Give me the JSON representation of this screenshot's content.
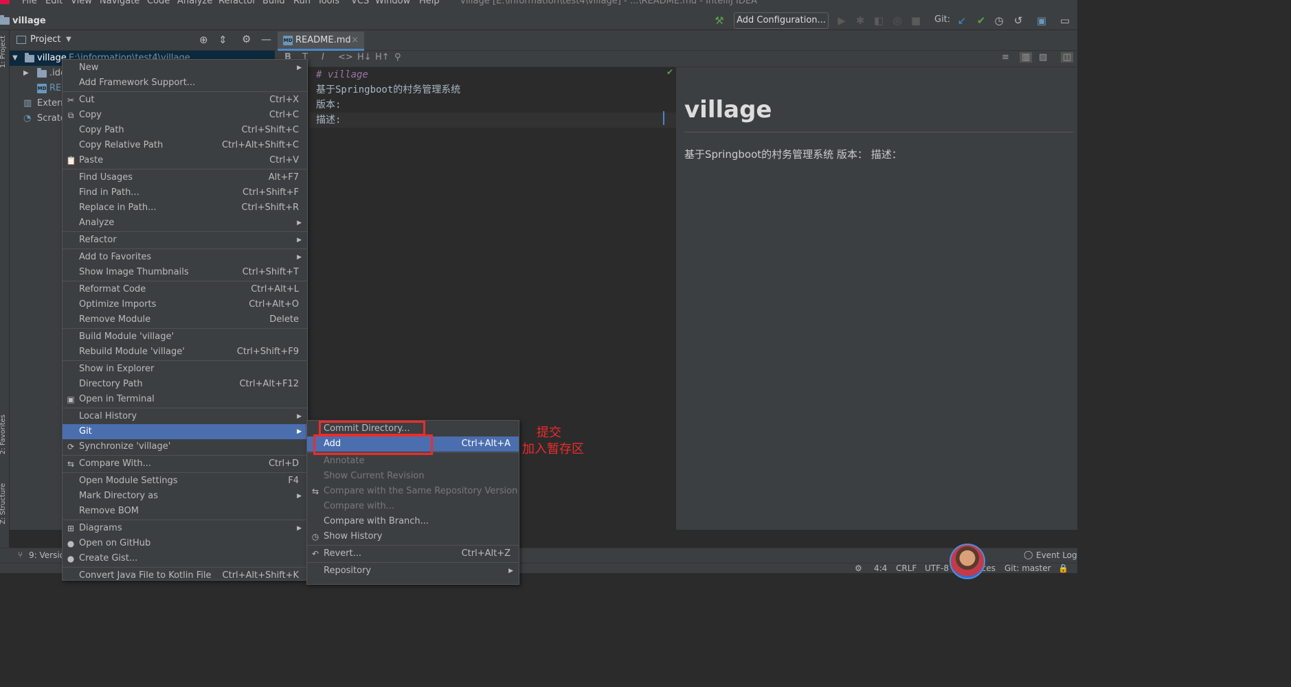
{
  "window_title": "village [E:\\information\\test4\\village] - ...\\README.md - IntelliJ IDEA",
  "menubar": [
    "File",
    "Edit",
    "View",
    "Navigate",
    "Code",
    "Analyze",
    "Refactor",
    "Build",
    "Run",
    "Tools",
    "VCS",
    "Window",
    "Help"
  ],
  "breadcrumb": "village",
  "toolbar": {
    "add_configuration": "Add Configuration...",
    "git_label": "Git:"
  },
  "left_strip": {
    "project": "1: Project",
    "favorites": "2: Favorites",
    "structure": "Z: Structure"
  },
  "project_panel": {
    "title": "Project",
    "root": {
      "name": "village",
      "path": "E:\\information\\test4\\village"
    },
    "items": [
      ".idea",
      "README.md",
      "External Libraries",
      "Scratches and Consoles"
    ]
  },
  "tree_visible": [
    ".ide",
    "RE",
    "Extern",
    "Scrato"
  ],
  "editor": {
    "tab": "README.md",
    "lines": [
      "# village",
      "基于Springboot的村务管理系统",
      "版本:",
      "描述:"
    ]
  },
  "preview": {
    "heading": "village",
    "paragraph": "基于Springboot的村务管理系统 版本： 描述："
  },
  "context_menu": [
    {
      "label": "New",
      "arrow": true
    },
    {
      "label": "Add Framework Support..."
    },
    {
      "sep": true
    },
    {
      "label": "Cut",
      "shortcut": "Ctrl+X",
      "icon": "scissors-icon"
    },
    {
      "label": "Copy",
      "shortcut": "Ctrl+C",
      "icon": "copy-icon"
    },
    {
      "label": "Copy Path",
      "shortcut": "Ctrl+Shift+C"
    },
    {
      "label": "Copy Relative Path",
      "shortcut": "Ctrl+Alt+Shift+C"
    },
    {
      "label": "Paste",
      "shortcut": "Ctrl+V",
      "icon": "paste-icon"
    },
    {
      "sep": true
    },
    {
      "label": "Find Usages",
      "shortcut": "Alt+F7"
    },
    {
      "label": "Find in Path...",
      "shortcut": "Ctrl+Shift+F"
    },
    {
      "label": "Replace in Path...",
      "shortcut": "Ctrl+Shift+R"
    },
    {
      "label": "Analyze",
      "arrow": true
    },
    {
      "sep": true
    },
    {
      "label": "Refactor",
      "arrow": true
    },
    {
      "sep": true
    },
    {
      "label": "Add to Favorites",
      "arrow": true
    },
    {
      "label": "Show Image Thumbnails",
      "shortcut": "Ctrl+Shift+T"
    },
    {
      "sep": true
    },
    {
      "label": "Reformat Code",
      "shortcut": "Ctrl+Alt+L"
    },
    {
      "label": "Optimize Imports",
      "shortcut": "Ctrl+Alt+O"
    },
    {
      "label": "Remove Module",
      "shortcut": "Delete"
    },
    {
      "sep": true
    },
    {
      "label": "Build Module 'village'"
    },
    {
      "label": "Rebuild Module 'village'",
      "shortcut": "Ctrl+Shift+F9"
    },
    {
      "sep": true
    },
    {
      "label": "Show in Explorer"
    },
    {
      "label": "Directory Path",
      "shortcut": "Ctrl+Alt+F12"
    },
    {
      "label": "Open in Terminal",
      "icon": "terminal-icon"
    },
    {
      "sep": true
    },
    {
      "label": "Local History",
      "arrow": true
    },
    {
      "label": "Git",
      "arrow": true,
      "selected": true
    },
    {
      "label": "Synchronize 'village'",
      "icon": "sync-icon"
    },
    {
      "sep": true
    },
    {
      "label": "Compare With...",
      "shortcut": "Ctrl+D",
      "icon": "compare-icon"
    },
    {
      "sep": true
    },
    {
      "label": "Open Module Settings",
      "shortcut": "F4"
    },
    {
      "label": "Mark Directory as",
      "arrow": true
    },
    {
      "label": "Remove BOM"
    },
    {
      "sep": true
    },
    {
      "label": "Diagrams",
      "arrow": true,
      "icon": "diagram-icon"
    },
    {
      "label": "Open on GitHub",
      "icon": "github-icon"
    },
    {
      "label": "Create Gist...",
      "icon": "github-icon"
    },
    {
      "sep": true
    },
    {
      "label": "Convert Java File to Kotlin File",
      "shortcut": "Ctrl+Alt+Shift+K"
    }
  ],
  "git_submenu": [
    {
      "label": "Commit Directory..."
    },
    {
      "label": "Add",
      "shortcut": "Ctrl+Alt+A",
      "selected": true
    },
    {
      "sep": true
    },
    {
      "label": "Annotate",
      "disabled": true
    },
    {
      "label": "Show Current Revision",
      "disabled": true
    },
    {
      "label": "Compare with the Same Repository Version",
      "disabled": true,
      "icon": "compare-icon"
    },
    {
      "label": "Compare with...",
      "disabled": true
    },
    {
      "label": "Compare with Branch..."
    },
    {
      "label": "Show History",
      "icon": "clock-icon"
    },
    {
      "sep": true
    },
    {
      "label": "Revert...",
      "shortcut": "Ctrl+Alt+Z",
      "icon": "revert-icon"
    },
    {
      "sep": true
    },
    {
      "label": "Repository",
      "arrow": true
    }
  ],
  "annotations": {
    "commit": "提交",
    "add": "加入暂存区"
  },
  "bottom_bar": {
    "version_control": "9: Version Control",
    "event_log": "Event Log"
  },
  "status_bar": {
    "position": "4:4",
    "line_sep": "CRLF",
    "encoding": "UTF-8",
    "spaces": "4 spaces",
    "git": "Git: master"
  }
}
